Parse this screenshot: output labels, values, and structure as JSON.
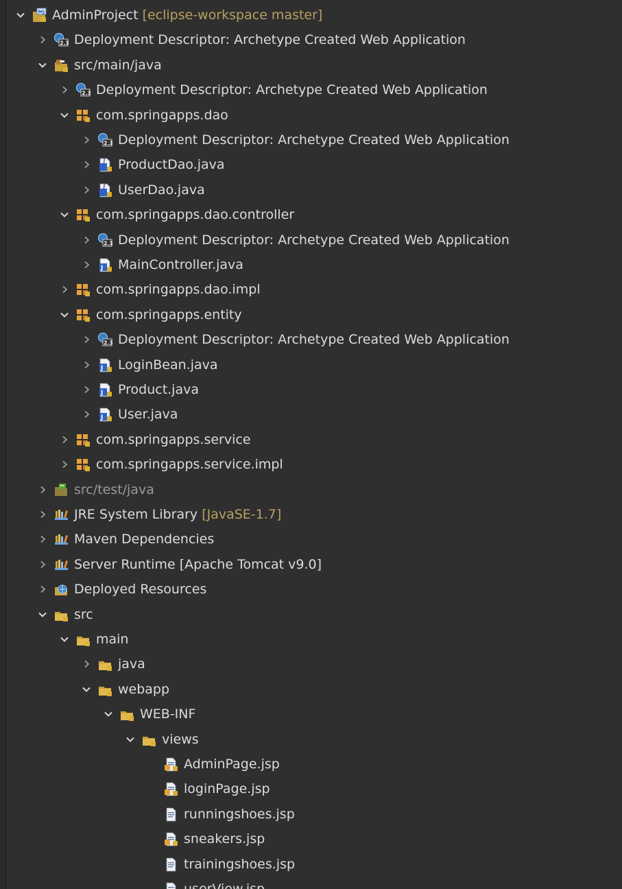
{
  "colors": {
    "background": "#2f2f2f",
    "text": "#dcdcdc",
    "decoration": "#b8a060",
    "dim_text": "#9a9a9a"
  },
  "tree": [
    {
      "name": "project-adminproject",
      "label": "AdminProject",
      "decoration": "[eclipse-workspace master]",
      "icon": "project-icon",
      "expanded": true,
      "level": 0
    },
    {
      "name": "deployment-descriptor",
      "label": "Deployment Descriptor: Archetype Created Web Application",
      "icon": "deployment-descriptor-icon",
      "expanded": false,
      "level": 1
    },
    {
      "name": "source-folder-src-main-java",
      "label": "src/main/java",
      "icon": "source-folder-icon",
      "expanded": true,
      "level": 1
    },
    {
      "name": "deployment-descriptor",
      "label": "Deployment Descriptor: Archetype Created Web Application",
      "icon": "deployment-descriptor-icon",
      "expanded": false,
      "level": 2
    },
    {
      "name": "package-com-springapps-dao",
      "label": "com.springapps.dao",
      "icon": "package-icon",
      "expanded": true,
      "level": 2
    },
    {
      "name": "deployment-descriptor",
      "label": "Deployment Descriptor: Archetype Created Web Application",
      "icon": "deployment-descriptor-icon",
      "expanded": false,
      "level": 3
    },
    {
      "name": "file-productdao-java",
      "label": "ProductDao.java",
      "icon": "java-interface-icon",
      "expanded": false,
      "level": 3
    },
    {
      "name": "file-userdao-java",
      "label": "UserDao.java",
      "icon": "java-interface-icon",
      "expanded": false,
      "level": 3
    },
    {
      "name": "package-com-springapps-dao-controller",
      "label": "com.springapps.dao.controller",
      "icon": "package-icon",
      "expanded": true,
      "level": 2
    },
    {
      "name": "deployment-descriptor",
      "label": "Deployment Descriptor: Archetype Created Web Application",
      "icon": "deployment-descriptor-icon",
      "expanded": false,
      "level": 3
    },
    {
      "name": "file-maincontroller-java",
      "label": "MainController.java",
      "icon": "java-file-icon",
      "expanded": false,
      "level": 3
    },
    {
      "name": "package-com-springapps-dao-impl",
      "label": "com.springapps.dao.impl",
      "icon": "package-icon",
      "expanded": false,
      "level": 2
    },
    {
      "name": "package-com-springapps-entity",
      "label": "com.springapps.entity",
      "icon": "package-icon",
      "expanded": true,
      "level": 2
    },
    {
      "name": "deployment-descriptor",
      "label": "Deployment Descriptor: Archetype Created Web Application",
      "icon": "deployment-descriptor-icon",
      "expanded": false,
      "level": 3
    },
    {
      "name": "file-loginbean-java",
      "label": "LoginBean.java",
      "icon": "java-file-icon",
      "expanded": false,
      "level": 3
    },
    {
      "name": "file-product-java",
      "label": "Product.java",
      "icon": "java-file-icon",
      "expanded": false,
      "level": 3
    },
    {
      "name": "file-user-java",
      "label": "User.java",
      "icon": "java-file-icon",
      "expanded": false,
      "level": 3
    },
    {
      "name": "package-com-springapps-service",
      "label": "com.springapps.service",
      "icon": "package-icon",
      "expanded": false,
      "level": 2
    },
    {
      "name": "package-com-springapps-service-impl",
      "label": "com.springapps.service.impl",
      "icon": "package-icon",
      "expanded": false,
      "level": 2
    },
    {
      "name": "source-folder-src-test-java",
      "label": "src/test/java",
      "icon": "source-folder-test-icon",
      "expanded": false,
      "level": 1,
      "dim": true
    },
    {
      "name": "library-jre-system",
      "label": "JRE System Library",
      "decoration": "[JavaSE-1.7]",
      "icon": "library-icon",
      "expanded": false,
      "level": 1
    },
    {
      "name": "library-maven-dependencies",
      "label": "Maven Dependencies",
      "icon": "library-icon",
      "expanded": false,
      "level": 1
    },
    {
      "name": "library-server-runtime",
      "label": "Server Runtime [Apache Tomcat v9.0]",
      "icon": "library-icon",
      "expanded": false,
      "level": 1
    },
    {
      "name": "deployed-resources",
      "label": "Deployed Resources",
      "icon": "deployed-resources-icon",
      "expanded": false,
      "level": 1
    },
    {
      "name": "folder-src",
      "label": "src",
      "icon": "folder-icon",
      "expanded": true,
      "level": 1
    },
    {
      "name": "folder-main",
      "label": "main",
      "icon": "folder-icon",
      "expanded": true,
      "level": 2
    },
    {
      "name": "folder-java",
      "label": "java",
      "icon": "folder-icon",
      "expanded": false,
      "level": 3
    },
    {
      "name": "folder-webapp",
      "label": "webapp",
      "icon": "folder-icon",
      "expanded": true,
      "level": 3
    },
    {
      "name": "folder-web-inf",
      "label": "WEB-INF",
      "icon": "folder-icon",
      "expanded": true,
      "level": 4
    },
    {
      "name": "folder-views",
      "label": "views",
      "icon": "folder-icon",
      "expanded": true,
      "level": 5
    },
    {
      "name": "file-adminpage-jsp",
      "label": "AdminPage.jsp",
      "icon": "jsp-tracked-icon",
      "level": 6,
      "leaf": true
    },
    {
      "name": "file-loginpage-jsp",
      "label": "loginPage.jsp",
      "icon": "jsp-tracked-icon",
      "level": 6,
      "leaf": true
    },
    {
      "name": "file-runningshoes-jsp",
      "label": "runningshoes.jsp",
      "icon": "jsp-file-icon",
      "level": 6,
      "leaf": true
    },
    {
      "name": "file-sneakers-jsp",
      "label": "sneakers.jsp",
      "icon": "jsp-tracked-icon",
      "level": 6,
      "leaf": true
    },
    {
      "name": "file-trainingshoes-jsp",
      "label": "trainingshoes.jsp",
      "icon": "jsp-file-icon",
      "level": 6,
      "leaf": true
    },
    {
      "name": "file-userview-jsp",
      "label": "userView.jsp",
      "icon": "jsp-tracked-icon",
      "level": 6,
      "leaf": true
    }
  ]
}
